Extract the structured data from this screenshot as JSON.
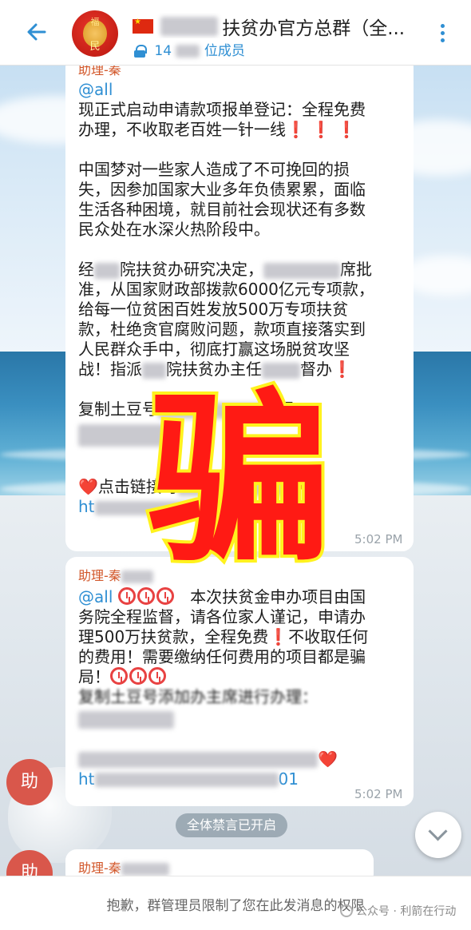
{
  "header": {
    "back_icon": "arrow-left-icon",
    "title": "扶贫办官方总群（全...",
    "members": "位成员",
    "member_count_visible": "14",
    "lock_icon": "lock-icon",
    "menu_icon": "more-vertical-icon",
    "avatar_text_top": "福",
    "avatar_text_bottom": "民"
  },
  "messages": [
    {
      "sender": "助理-秦",
      "mention": "@all",
      "para1_a": "现正式启动申请款项报单登记：全程免费",
      "para1_b": "办理，不收取老百姓一针一线",
      "para1_bangs": "❗ ❗ ❗",
      "para2_a": "中国梦对一些家人造成了不可挽回的损",
      "para2_b": "失，因参加国家大业多年负债累累，面临",
      "para2_c": "生活各种困境，就目前社会现状还有多数",
      "para2_d": "民众处在水深火热阶段中。",
      "para3_a1": "经",
      "para3_a2": "院扶贫办研究决定，",
      "para3_a3": "席批",
      "para3_b": "准，从国家财政部拨款6000亿元专项款，",
      "para3_c": "给每一位贫困百姓发放500万专项扶贫",
      "para3_d": "款，杜绝贪官腐败问题，款项直接落实到",
      "para3_e": "人民群众手中，彻底打赢这场脱贫攻坚",
      "para3_f1": "战！指派",
      "para3_f2": "院扶贫办主任",
      "para3_f3": "督办",
      "para3_bang": "❗",
      "para4": "复制土豆号",
      "para4_tail": "理：",
      "para5_heart": "❤️",
      "para5_text": "点击链接可",
      "para5_heart2": "❤️",
      "link_prefix": "ht",
      "time": "5:02 PM"
    },
    {
      "sender": "助理-秦",
      "mention": "@all",
      "line1_text": "本次扶贫金申办项目由国",
      "line2": "务院全程监督，请各位家人谨记，申请办",
      "line3_a": "理500万扶贫款，全程免费",
      "line3_bang": "❗",
      "line3_b": "不收取任何",
      "line4": "的费用！需要缴纳任何费用的项目都是骗",
      "line5": "局！",
      "line6": "复制土豆号添加办主席进行办理：",
      "heart": "❤️",
      "link_prefix": "ht",
      "link_suffix": "01",
      "time": "5:02 PM"
    },
    {
      "sender": "助理-秦"
    }
  ],
  "overlay": {
    "stamp_text": "骗"
  },
  "side_avatars": [
    {
      "text": "助"
    },
    {
      "text": "助"
    }
  ],
  "notice": "全体禁言已开启",
  "scroll_down_icon": "chevron-down-icon",
  "footer": {
    "restriction_text": "抱歉，群管理员限制了您在此发消息的权限"
  },
  "watermark": {
    "text": "公众号 · 利箭在行动"
  },
  "colors": {
    "accent": "#2f8fd3",
    "sender": "#d2572a",
    "stamp_fill": "#ff1a14",
    "stamp_outline": "#fff21e"
  }
}
